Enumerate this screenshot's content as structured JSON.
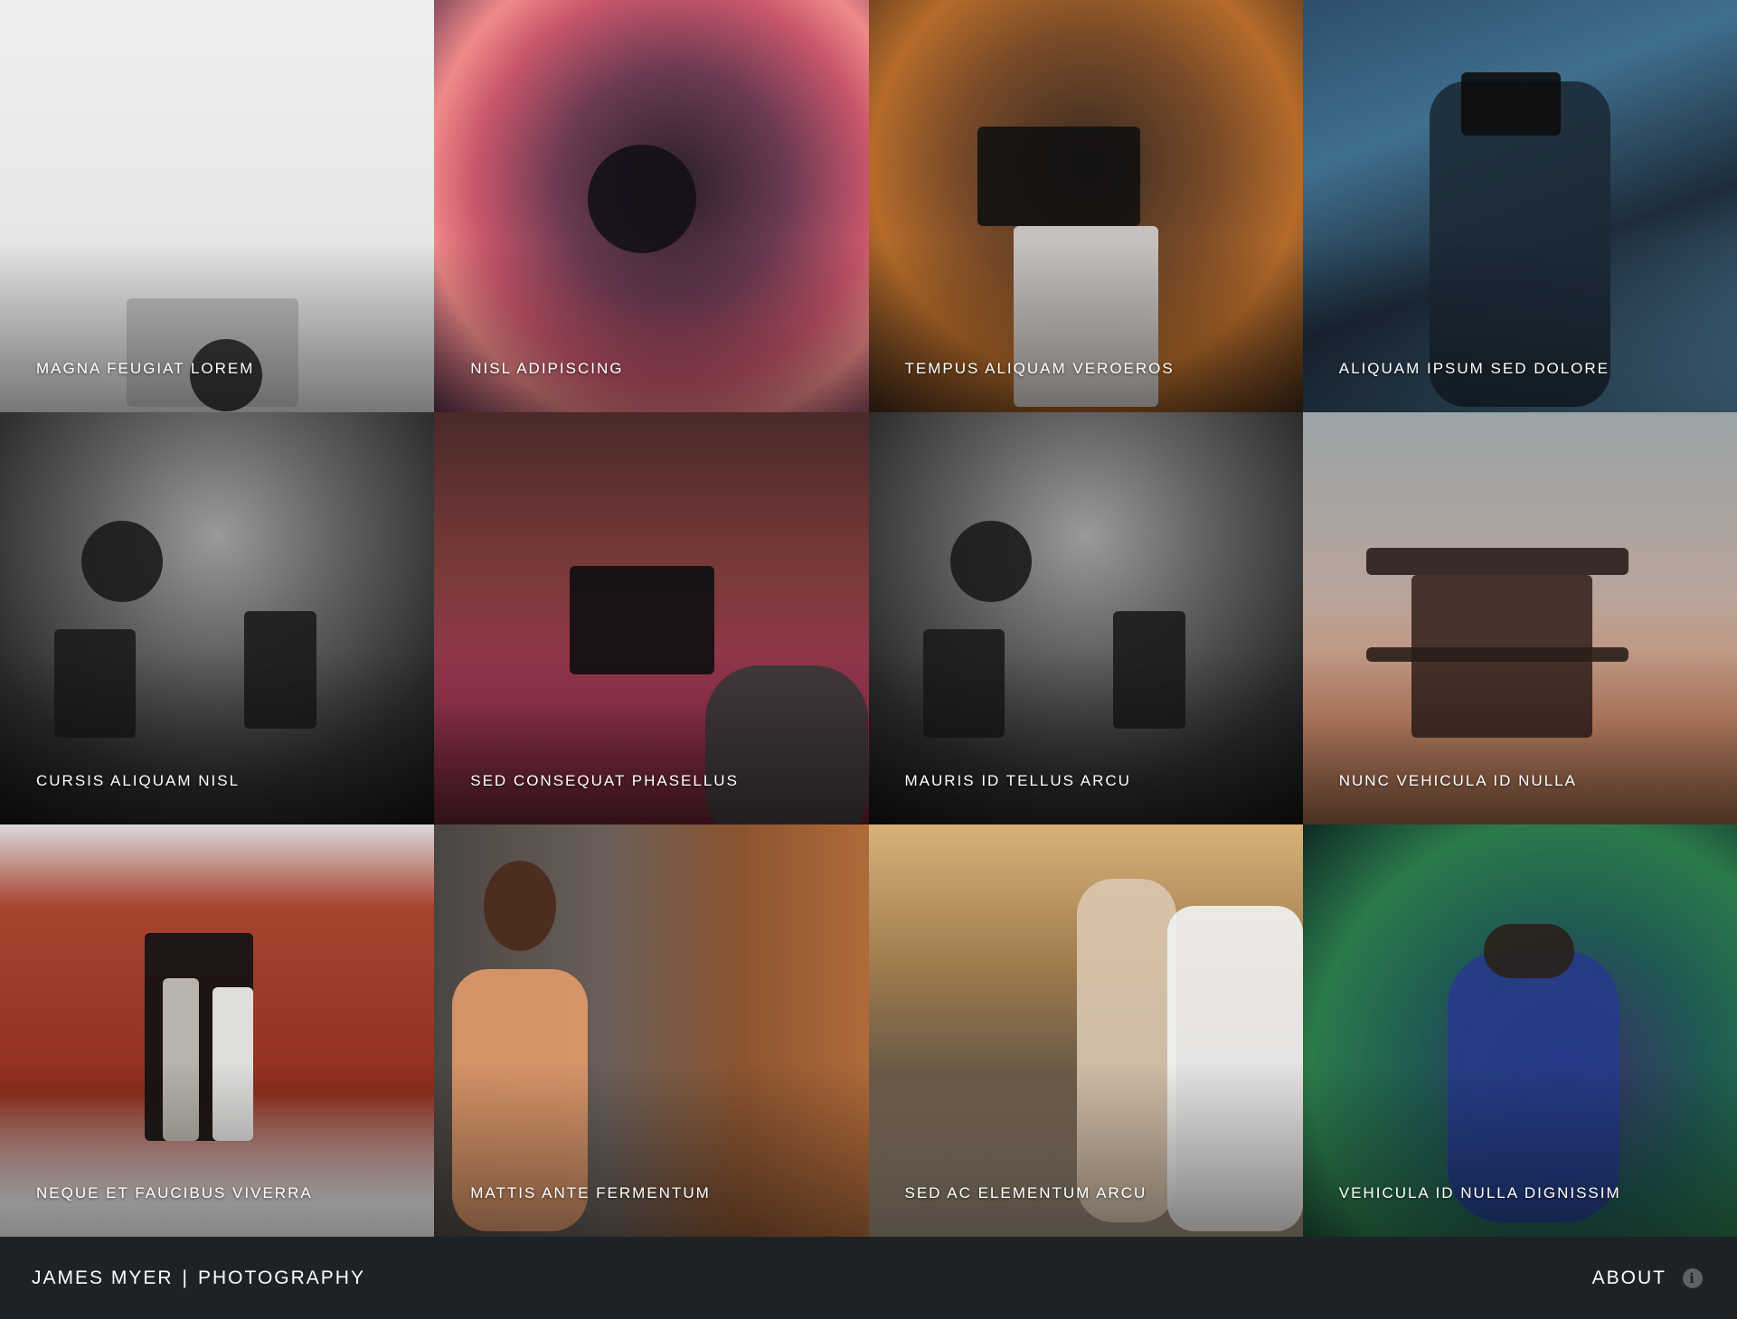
{
  "gallery": {
    "tiles": [
      {
        "caption": "MAGNA FEUGIAT LOREM"
      },
      {
        "caption": "NISL ADIPISCING"
      },
      {
        "caption": "TEMPUS ALIQUAM VEROEROS"
      },
      {
        "caption": "ALIQUAM IPSUM SED DOLORE"
      },
      {
        "caption": "CURSIS ALIQUAM NISL"
      },
      {
        "caption": "SED CONSEQUAT PHASELLUS"
      },
      {
        "caption": "MAURIS ID TELLUS ARCU"
      },
      {
        "caption": "NUNC VEHICULA ID NULLA"
      },
      {
        "caption": "NEQUE ET FAUCIBUS VIVERRA"
      },
      {
        "caption": "MATTIS ANTE FERMENTUM"
      },
      {
        "caption": "SED AC ELEMENTUM ARCU"
      },
      {
        "caption": "VEHICULA ID NULLA DIGNISSIM"
      }
    ]
  },
  "footer": {
    "brand_name": "JAMES MYER",
    "brand_separator": "|",
    "brand_tagline": "PHOTOGRAPHY",
    "about_label": "ABOUT",
    "about_icon": "info-icon"
  },
  "colors": {
    "footer_background": "#1f2224",
    "caption_text": "#ffffff",
    "info_icon": "#5e6366"
  }
}
